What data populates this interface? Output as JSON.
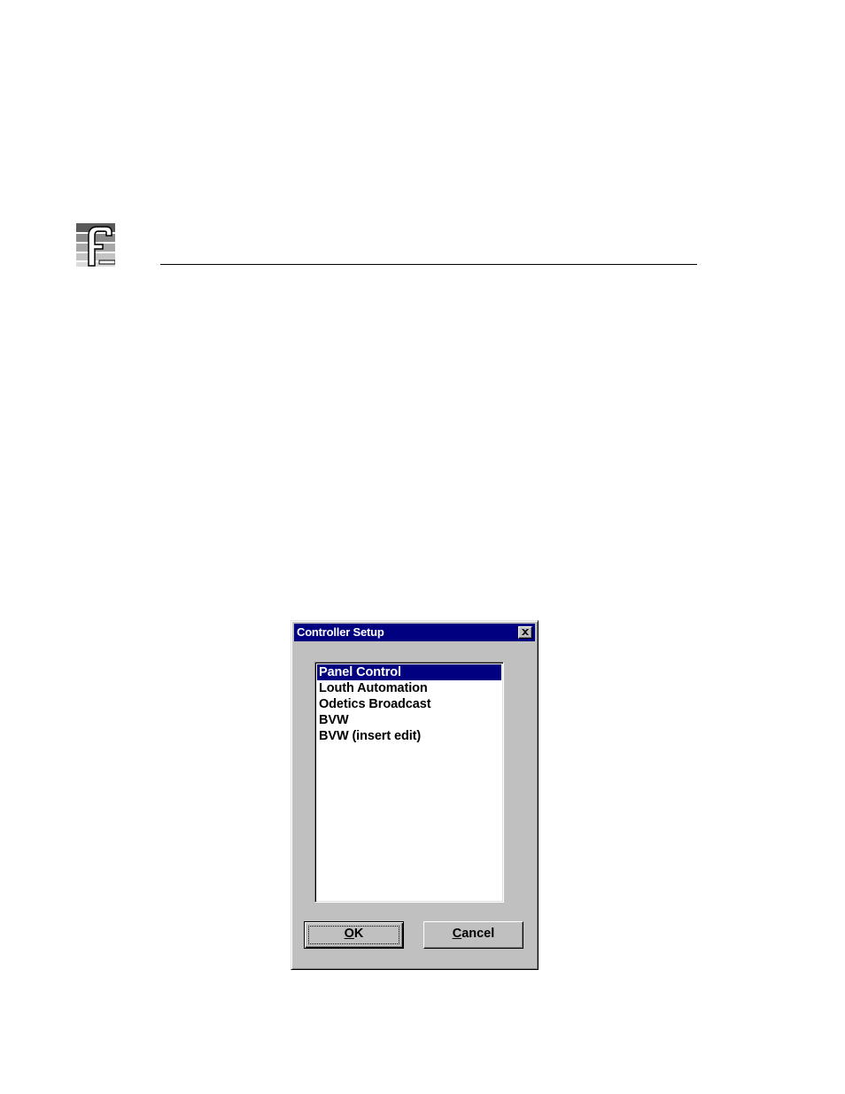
{
  "dialog": {
    "title": "Controller Setup",
    "icons": {
      "close": "close-icon",
      "logo": "company-logo"
    },
    "list": {
      "items": [
        "Panel Control",
        "Louth Automation",
        "Odetics Broadcast",
        "BVW",
        "BVW (insert edit)"
      ],
      "selected_index": 0
    },
    "buttons": {
      "ok": {
        "mnemonic": "O",
        "rest": "K"
      },
      "cancel": {
        "mnemonic": "C",
        "rest": "ancel"
      }
    },
    "colors": {
      "titlebar": "#000080",
      "face": "#c0c0c0",
      "selection": "#000080"
    }
  }
}
